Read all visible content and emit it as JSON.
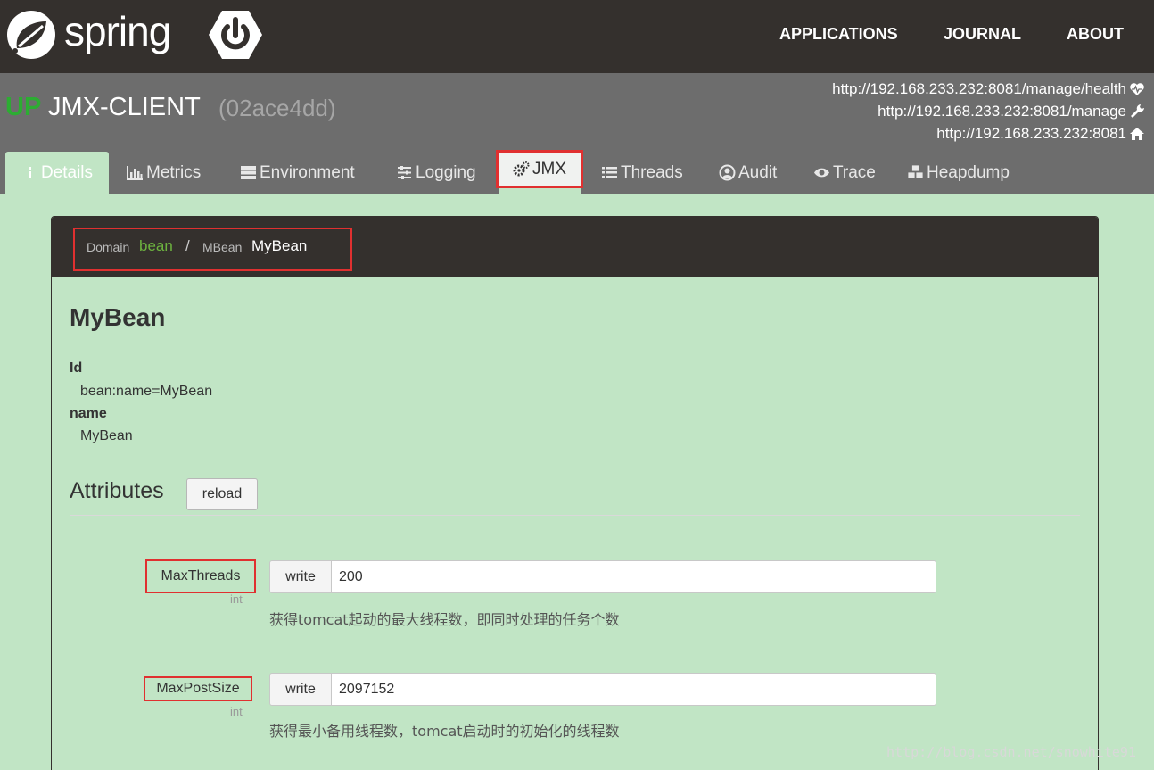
{
  "navbar": {
    "logo_text": "spring",
    "links": [
      "APPLICATIONS",
      "JOURNAL",
      "ABOUT"
    ]
  },
  "app": {
    "status": "UP",
    "name": "JMX-CLIENT",
    "id": "(02ace4dd)",
    "urls": {
      "health": "http://192.168.233.232:8081/manage/health",
      "manage": "http://192.168.233.232:8081/manage",
      "home": "http://192.168.233.232:8081"
    }
  },
  "tabs": {
    "details": "Details",
    "metrics": "Metrics",
    "environment": "Environment",
    "logging": "Logging",
    "jmx": "JMX",
    "threads": "Threads",
    "audit": "Audit",
    "trace": "Trace",
    "heapdump": "Heapdump"
  },
  "breadcrumb": {
    "domain_label": "Domain",
    "domain_value": "bean",
    "separator": "/",
    "mbean_label": "MBean",
    "mbean_value": "MyBean"
  },
  "bean": {
    "title": "MyBean",
    "props": [
      {
        "key": "Id",
        "value": "bean:name=MyBean"
      },
      {
        "key": "name",
        "value": "MyBean"
      }
    ]
  },
  "attributes": {
    "heading": "Attributes",
    "reload_label": "reload",
    "items": [
      {
        "name": "MaxThreads",
        "type": "int",
        "write_label": "write",
        "value": "200",
        "description": "获得tomcat起动的最大线程数，即同时处理的任务个数"
      },
      {
        "name": "MaxPostSize",
        "type": "int",
        "write_label": "write",
        "value": "2097152",
        "description": "获得最小备用线程数，tomcat启动时的初始化的线程数"
      }
    ]
  },
  "watermark": "http://blog.csdn.net/snowhite91",
  "colors": {
    "navbar": "#34302d",
    "header": "#6d6d6d",
    "page_bg": "#c1e5c5",
    "up_green": "#2cad32",
    "highlight_red": "#e03030"
  }
}
